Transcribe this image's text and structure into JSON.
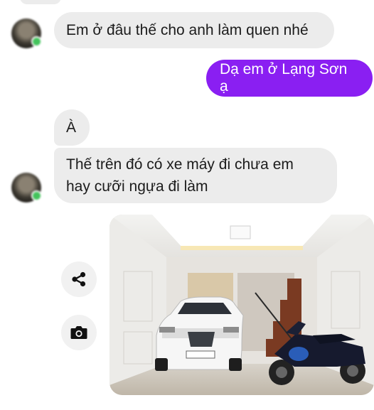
{
  "messages": [
    {
      "sender": "other",
      "text": "Em ở đâu thế cho anh làm quen nhé"
    },
    {
      "sender": "me",
      "text": "Dạ em ở Lạng Sơn ạ"
    },
    {
      "sender": "other",
      "text": "À"
    },
    {
      "sender": "other",
      "lines": [
        "Thế trên đó có xe máy đi chưa em",
        "hay cưỡi ngựa đi làm"
      ]
    }
  ],
  "photo": {
    "plate_text": "30A-XXX",
    "description": "garage"
  },
  "actions": [
    "share-icon",
    "camera-icon"
  ],
  "colors": {
    "sent_bubble": "#8a1ff2",
    "received_bubble": "#ececec",
    "online": "#43c35c"
  }
}
